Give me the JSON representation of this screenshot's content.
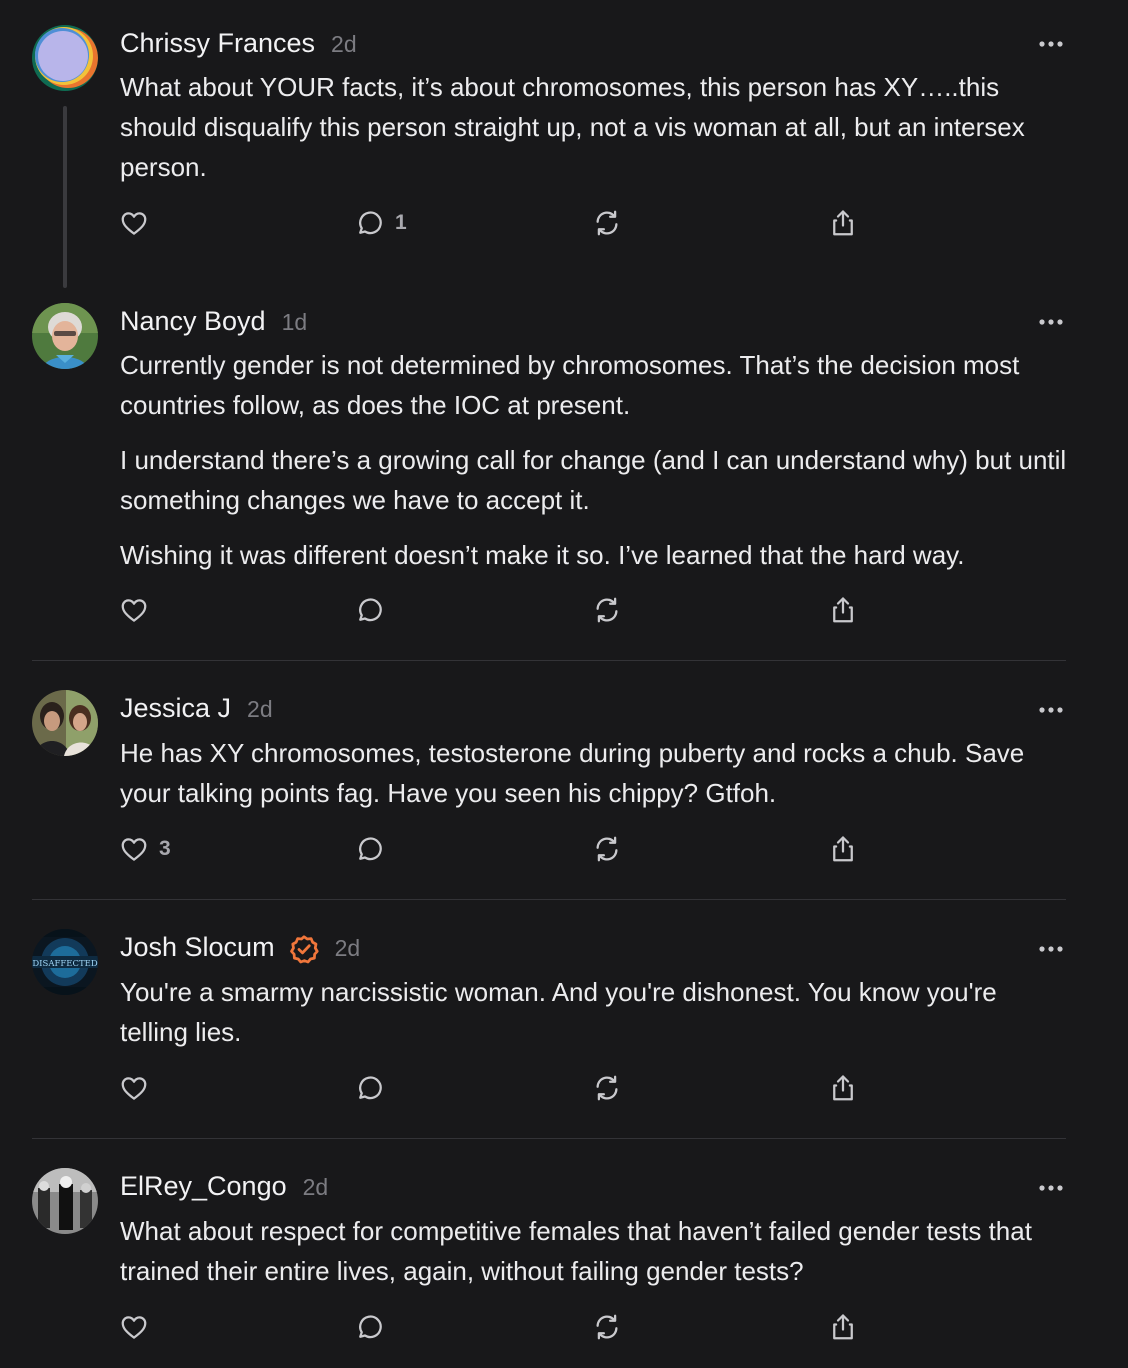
{
  "colors": {
    "background": "#18181a",
    "text": "#ececee",
    "muted": "#7c7c82",
    "icon": "#c9c9cd",
    "verified": "#f0763b",
    "divider": "#333337"
  },
  "comments": [
    {
      "author": "Chrissy Frances",
      "time": "2d",
      "verified": false,
      "paragraphs": [
        "What about YOUR facts, it’s about chromosomes, this person has XY…..this should disqualify this person straight up, not a vis woman at all, but an intersex person."
      ],
      "likes": "",
      "replies": "1",
      "avatar": "abstract-color-avatar"
    },
    {
      "author": "Nancy Boyd",
      "time": "1d",
      "verified": false,
      "paragraphs": [
        "Currently gender is not determined by chromosomes. That’s the decision most countries follow, as does the IOC at present.",
        "I understand there’s a growing call for change (and I can understand why) but until something changes we have to accept it.",
        "Wishing it was different doesn’t make it so. I’ve learned that the hard way."
      ],
      "likes": "",
      "replies": "",
      "avatar": "portrait-avatar"
    },
    {
      "author": "Jessica J",
      "time": "2d",
      "verified": false,
      "paragraphs": [
        "He has XY chromosomes, testosterone during puberty and rocks a chub. Save your talking points fag. Have you seen his chippy? Gtfoh."
      ],
      "likes": "3",
      "replies": "",
      "avatar": "photo-avatar"
    },
    {
      "author": "Josh Slocum",
      "time": "2d",
      "verified": true,
      "paragraphs": [
        "You're a smarmy narcissistic woman. And you're dishonest. You know you're telling lies."
      ],
      "likes": "",
      "replies": "",
      "avatar": "disaffected-avatar",
      "avatar_text": "DISAFFECTED"
    },
    {
      "author": "ElRey_Congo",
      "time": "2d",
      "verified": false,
      "paragraphs": [
        "What about respect for competitive females that haven’t failed gender tests that trained their entire lives, again, without failing gender tests?"
      ],
      "likes": "",
      "replies": "",
      "avatar": "bw-photo-avatar"
    }
  ]
}
